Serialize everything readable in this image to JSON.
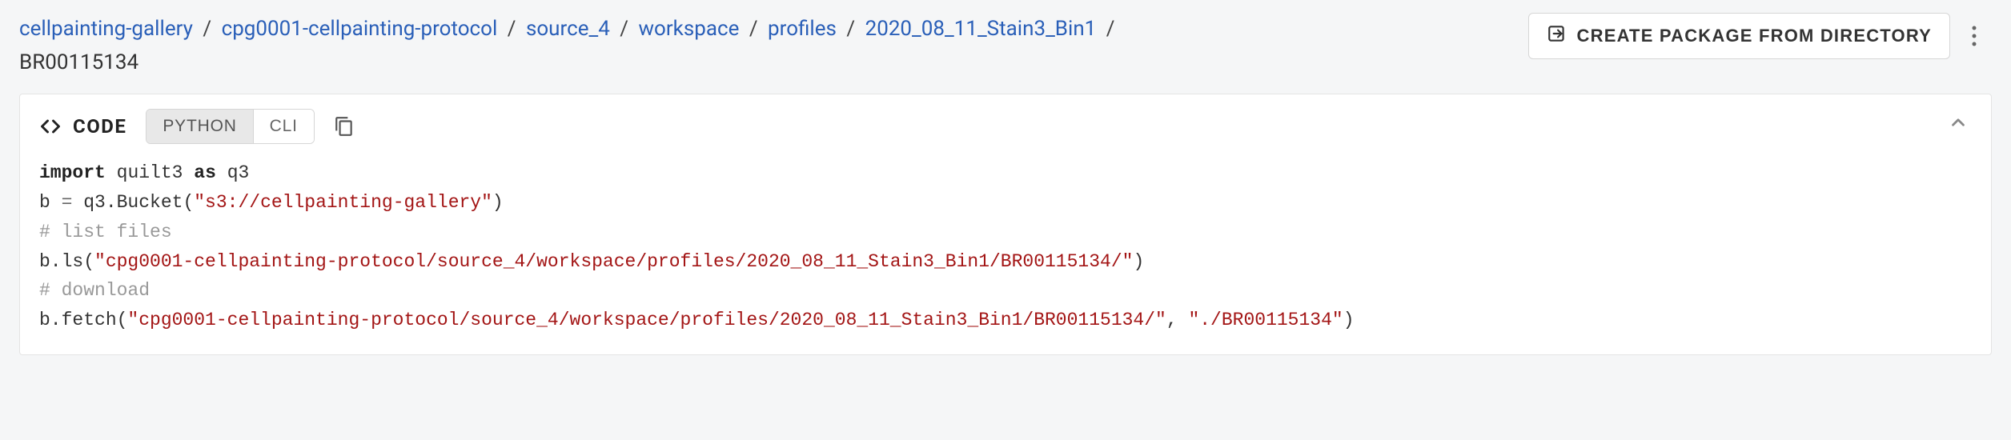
{
  "breadcrumb": {
    "items": [
      {
        "label": "cellpainting-gallery"
      },
      {
        "label": "cpg0001-cellpainting-protocol"
      },
      {
        "label": "source_4"
      },
      {
        "label": "workspace"
      },
      {
        "label": "profiles"
      },
      {
        "label": "2020_08_11_Stain3_Bin1"
      }
    ],
    "current": "BR00115134",
    "sep": "/"
  },
  "header": {
    "create_package_label": "CREATE PACKAGE FROM DIRECTORY"
  },
  "code_panel": {
    "label": "CODE",
    "tabs": {
      "python": "PYTHON",
      "cli": "CLI"
    },
    "code": {
      "line1_kw": "import",
      "line1_mod": "quilt3",
      "line1_as": "as",
      "line1_alias": "q3",
      "line2_lhs": "b ",
      "line2_op": "=",
      "line2_call_pre": " q3.Bucket(",
      "line2_str": "\"s3://cellpainting-gallery\"",
      "line2_call_post": ")",
      "line3_comment": "# list files",
      "line4_pre": "b.ls(",
      "line4_str": "\"cpg0001-cellpainting-protocol/source_4/workspace/profiles/2020_08_11_Stain3_Bin1/BR00115134/\"",
      "line4_post": ")",
      "line5_comment": "# download",
      "line6_pre": "b.fetch(",
      "line6_str1": "\"cpg0001-cellpainting-protocol/source_4/workspace/profiles/2020_08_11_Stain3_Bin1/BR00115134/\"",
      "line6_mid": ", ",
      "line6_str2": "\"./BR00115134\"",
      "line6_post": ")"
    }
  }
}
